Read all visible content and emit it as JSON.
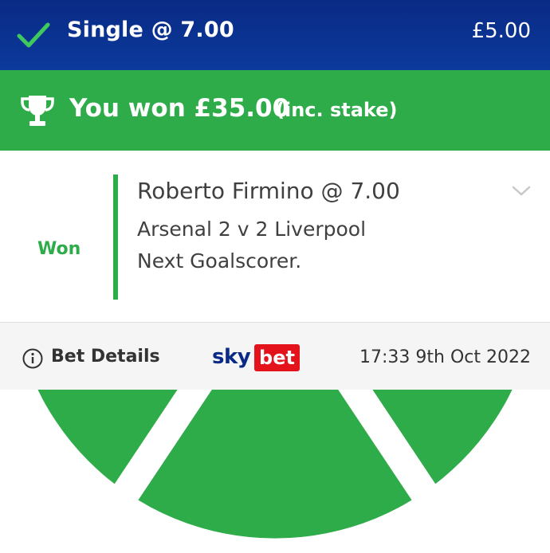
{
  "header": {
    "title": "Single @ 7.00",
    "stake": "£5.00",
    "status_icon": "check-icon"
  },
  "result_banner": {
    "amount_text": "You won £35.00",
    "note": "(inc. stake)",
    "icon": "trophy-icon",
    "color": "#2fac4a"
  },
  "selection": {
    "name": "Roberto Firmino @ 7.00",
    "event": "Arsenal 2 v 2 Liverpool",
    "market": "Next Goalscorer.",
    "status": "Won",
    "sport_icon": "football-icon"
  },
  "footer": {
    "details_label": "Bet Details",
    "logo_sky": "sky",
    "logo_bet": "bet",
    "timestamp": "17:33 9th Oct 2022"
  },
  "colors": {
    "header_bg": "#0b3a9c",
    "win_green": "#2fac4a",
    "logo_red": "#e3121b"
  }
}
